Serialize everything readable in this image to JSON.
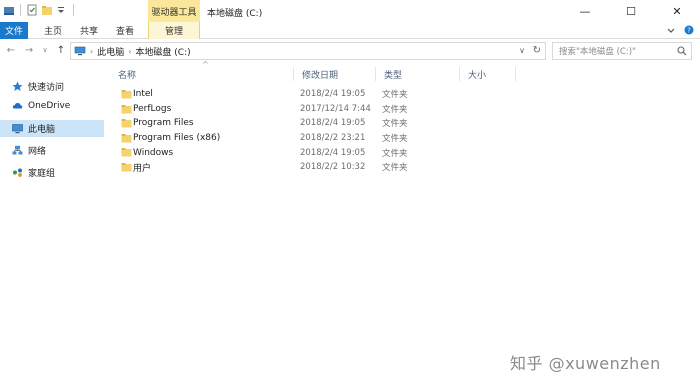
{
  "titlebar": {
    "context_tab_header": "驱动器工具",
    "window_title": "本地磁盘 (C:)",
    "minimize": "—",
    "maximize": "☐",
    "close": "✕"
  },
  "ribbon": {
    "tabs": [
      {
        "label": "文件"
      },
      {
        "label": "主页"
      },
      {
        "label": "共享"
      },
      {
        "label": "查看"
      },
      {
        "label": "管理"
      }
    ],
    "help": "?"
  },
  "navigation": {
    "back": "←",
    "forward": "→",
    "recent": "∨",
    "up": "↑",
    "breadcrumbs": [
      "此电脑",
      "本地磁盘 (C:)"
    ],
    "breadcrumb_separator": "›",
    "dropdown": "∨",
    "refresh": "↻",
    "search_placeholder": "搜索\"本地磁盘 (C:)\""
  },
  "sidebar": {
    "items": [
      {
        "label": "快速访问",
        "icon": "star-icon"
      },
      {
        "label": "OneDrive",
        "icon": "cloud-icon"
      },
      {
        "label": "此电脑",
        "icon": "computer-icon",
        "selected": true
      },
      {
        "label": "网络",
        "icon": "network-icon"
      },
      {
        "label": "家庭组",
        "icon": "homegroup-icon"
      }
    ]
  },
  "columns": {
    "name": "名称",
    "date": "修改日期",
    "type": "类型",
    "size": "大小",
    "sort_indicator": "^"
  },
  "files": [
    {
      "name": "Intel",
      "date": "2018/2/4 19:05",
      "type": "文件夹"
    },
    {
      "name": "PerfLogs",
      "date": "2017/12/14 7:44",
      "type": "文件夹"
    },
    {
      "name": "Program Files",
      "date": "2018/2/4 19:05",
      "type": "文件夹"
    },
    {
      "name": "Program Files (x86)",
      "date": "2018/2/2 23:21",
      "type": "文件夹"
    },
    {
      "name": "Windows",
      "date": "2018/2/4 19:05",
      "type": "文件夹"
    },
    {
      "name": "用户",
      "date": "2018/2/2 10:32",
      "type": "文件夹"
    }
  ],
  "watermark": "知乎 @xuwenzhen",
  "colors": {
    "accent": "#1979ca",
    "context_tab": "#fbe79a",
    "selected_nav": "#cce4f7",
    "folder": "#f5d26b"
  }
}
